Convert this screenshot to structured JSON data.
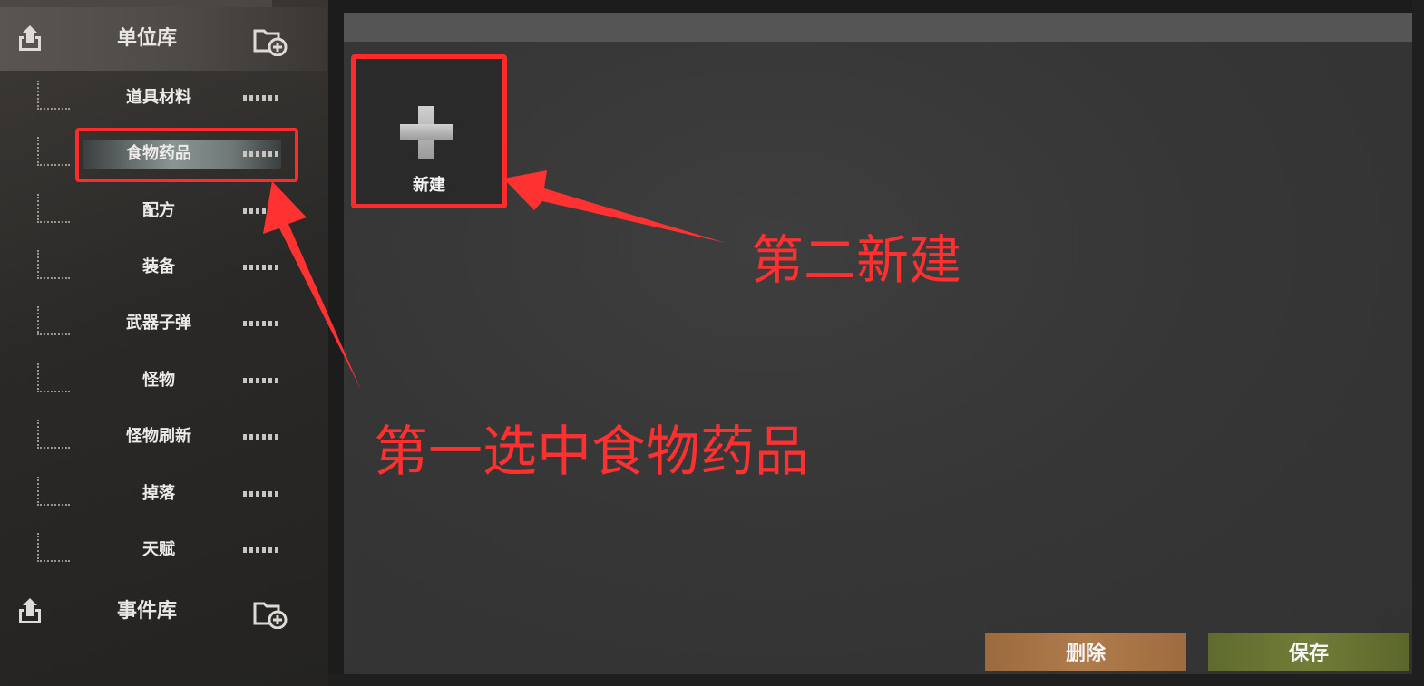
{
  "sidebar": {
    "unit_library": {
      "title": "单位库",
      "export_icon": "export-icon",
      "add_folder_icon": "add-folder-icon"
    },
    "categories": [
      {
        "label": "道具材料",
        "selected": false
      },
      {
        "label": "食物药品",
        "selected": true
      },
      {
        "label": "配方",
        "selected": false
      },
      {
        "label": "装备",
        "selected": false
      },
      {
        "label": "武器子弹",
        "selected": false
      },
      {
        "label": "怪物",
        "selected": false
      },
      {
        "label": "怪物刷新",
        "selected": false
      },
      {
        "label": "掉落",
        "selected": false
      },
      {
        "label": "天赋",
        "selected": false
      }
    ],
    "event_library": {
      "title": "事件库",
      "export_icon": "export-icon",
      "add_folder_icon": "add-folder-icon"
    }
  },
  "main": {
    "new_card": {
      "label": "新建",
      "icon": "plus-icon"
    }
  },
  "annotations": {
    "second": "第二新建",
    "first": "第一选中食物药品",
    "color": "#ff2b2b"
  },
  "footer": {
    "delete_label": "删除",
    "save_label": "保存",
    "delete_color": "#a97545",
    "save_color": "#6a7533"
  }
}
